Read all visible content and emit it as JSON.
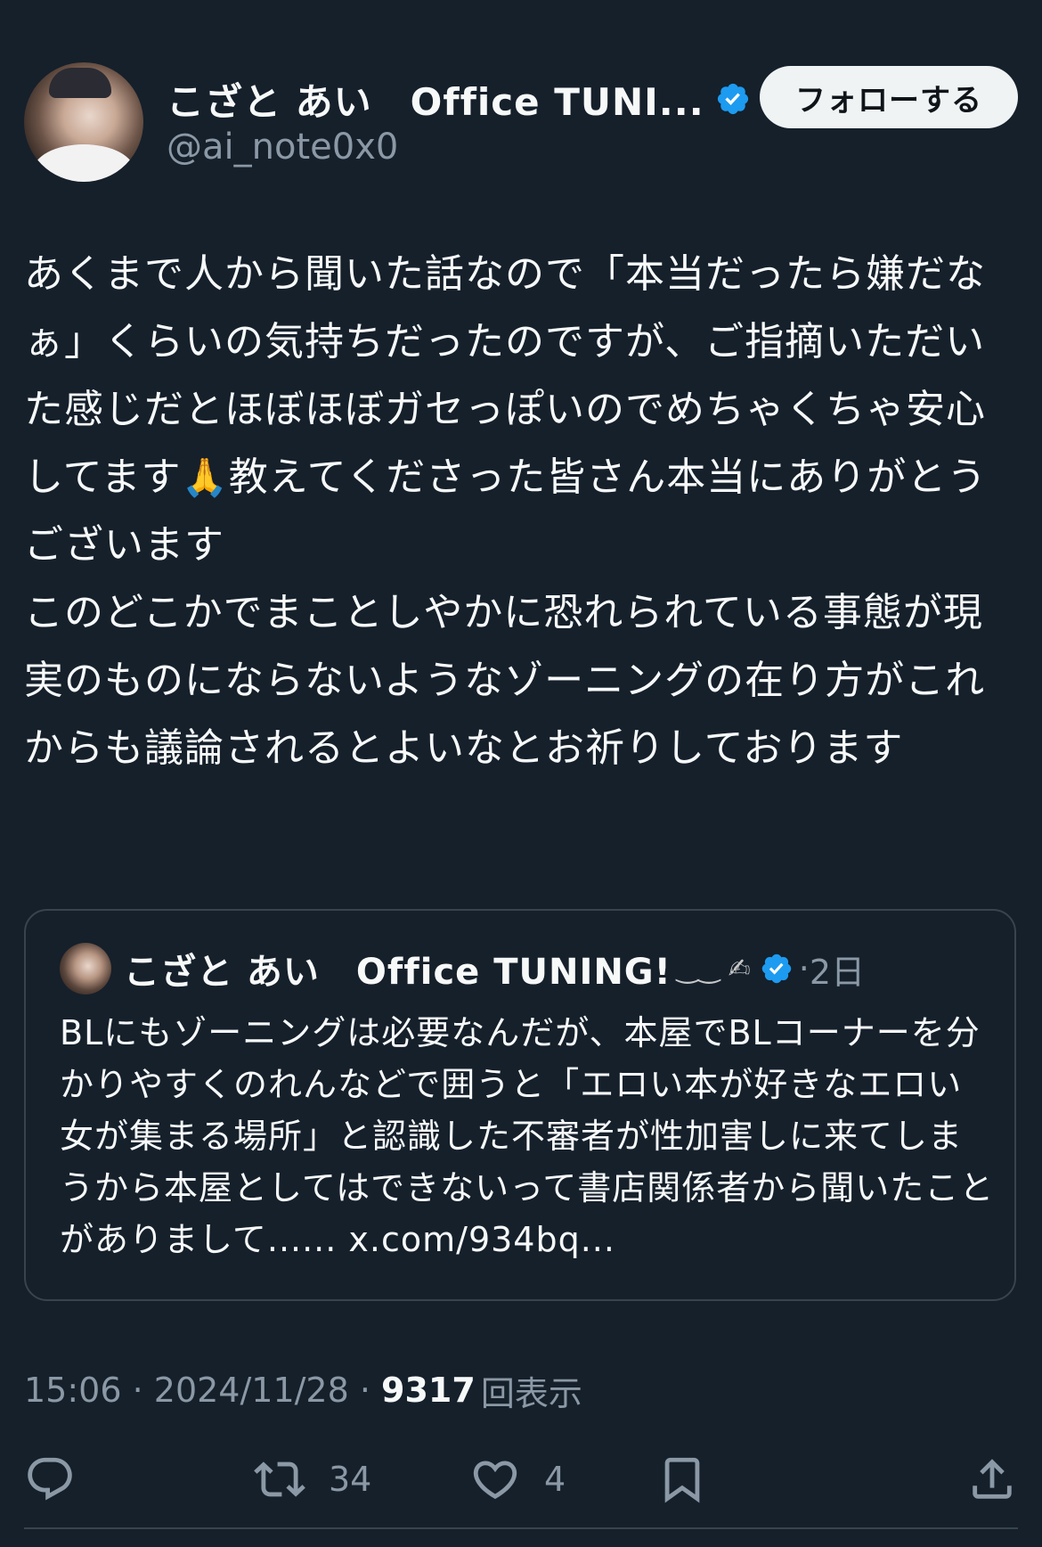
{
  "author": {
    "name": "こざと あい　Office TUNI...",
    "handle": "@ai_note0x0",
    "avatar_icon": "user-avatar"
  },
  "follow_button": {
    "label": "フォローする"
  },
  "tweet": {
    "text_part1": "あくまで人から聞いた話なので「本当だったら嫌だなぁ」くらいの気持ちだったのですが、ご指摘いただいた感じだとほぼほぼガセっぽいのでめちゃくちゃ安心してます",
    "emoji": "🙏",
    "text_part2": "教えてくださった皆さん本当にありがとうございます\nこのどこかでまことしやかに恐れられている事態が現実のものにならないようなゾーニングの在り方がこれからも議論されるとよいなとお祈りしております"
  },
  "quote": {
    "name": "こざと あい　Office TUNING!",
    "decoration": "‿‿ ✍",
    "separator": "·",
    "date": "2日",
    "text": "BLにもゾーニングは必要なんだが、本屋でBLコーナーを分かりやすくのれんなどで囲うと「エロい本が好きなエロい女が集まる場所」と認識した不審者が性加害しに来てしまうから本屋としてはできないって書店関係者から聞いたことがありまして...... x.com/934bq..."
  },
  "meta": {
    "time": "15:06",
    "sep1": " · ",
    "date": "2024/11/28",
    "sep2": " · ",
    "views_count": "9317",
    "views_label": "回表示"
  },
  "actions": {
    "reply": {
      "icon": "reply-icon",
      "count": ""
    },
    "retweet": {
      "icon": "retweet-icon",
      "count": "34"
    },
    "like": {
      "icon": "heart-icon",
      "count": "4"
    },
    "bookmark": {
      "icon": "bookmark-icon"
    },
    "share": {
      "icon": "share-icon"
    }
  },
  "colors": {
    "background": "#15202b",
    "text": "#f7f9f9",
    "secondary": "#8b98a5",
    "verified": "#1d9bf0",
    "border": "#38444d"
  }
}
